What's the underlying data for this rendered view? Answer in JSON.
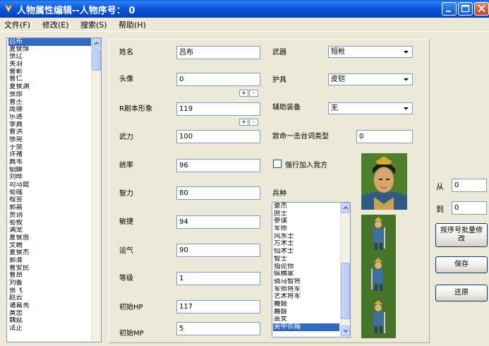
{
  "window": {
    "title": "人物属性编辑--人物序号： 0"
  },
  "menu": [
    "文件(F)",
    "修改(E)",
    "搜索(S)",
    "帮助(H)"
  ],
  "characters": [
    "吕布",
    "夏侯惇",
    "张辽",
    "关羽",
    "曹彰",
    "曹仁",
    "夏侯渊",
    "张郃",
    "曹丕",
    "庞德",
    "乐进",
    "李典",
    "曹洪",
    "徐晃",
    "于禁",
    "许褚",
    "典韦",
    "貂蝉",
    "刘晔",
    "司马懿",
    "荀彧",
    "程昱",
    "郭嘉",
    "贾诩",
    "荀攸",
    "满宠",
    "夏侯恩",
    "文聘",
    "夏侯杰",
    "郭淮",
    "曹安民",
    "曹昂",
    "刘备",
    "张飞",
    "赵云",
    "诸葛亮",
    "黄忠",
    "魏延",
    "法正"
  ],
  "selected_character_index": 0,
  "fields": {
    "name": {
      "label": "姓名",
      "value": "吕布"
    },
    "head": {
      "label": "头像",
      "value": "0"
    },
    "rshape": {
      "label": "R剧本形象",
      "value": "119"
    },
    "force": {
      "label": "武力",
      "value": "100"
    },
    "lead": {
      "label": "统率",
      "value": "96"
    },
    "intel": {
      "label": "智力",
      "value": "80"
    },
    "agility": {
      "label": "敏捷",
      "value": "94"
    },
    "luck": {
      "label": "运气",
      "value": "90"
    },
    "level": {
      "label": "等级",
      "value": "1"
    },
    "hp": {
      "label": "初始HP",
      "value": "117"
    },
    "mp": {
      "label": "初始MP",
      "value": "5"
    }
  },
  "equipment": {
    "weapon": {
      "label": "武器",
      "value": "短枪"
    },
    "armor": {
      "label": "护具",
      "value": "皮铠"
    },
    "accessory": {
      "label": "辅助装备",
      "value": "无"
    }
  },
  "critical": {
    "label": "致命一击台词类型",
    "value": "0"
  },
  "force_join": {
    "label": "强行加入我方",
    "checked": false
  },
  "unit": {
    "label": "兵种",
    "items": [
      "豪杰",
      "庶士",
      "参谋",
      "军师",
      "风水士",
      "方术士",
      "仙术士",
      "智士",
      "指论师",
      "纵横家",
      "骑马智将",
      "军师将军",
      "艺术将军",
      "舞姬",
      "舞姬",
      "巫女",
      "英中衣箱"
    ],
    "selected_index": 16
  },
  "spinner": {
    "plus": "+",
    "minus": "-"
  },
  "range": {
    "from_label": "从",
    "from_value": "0",
    "to_label": "到",
    "to_value": "0"
  },
  "buttons": {
    "batch_modify": "按序号批量修改",
    "save": "保存",
    "restore": "还原"
  }
}
